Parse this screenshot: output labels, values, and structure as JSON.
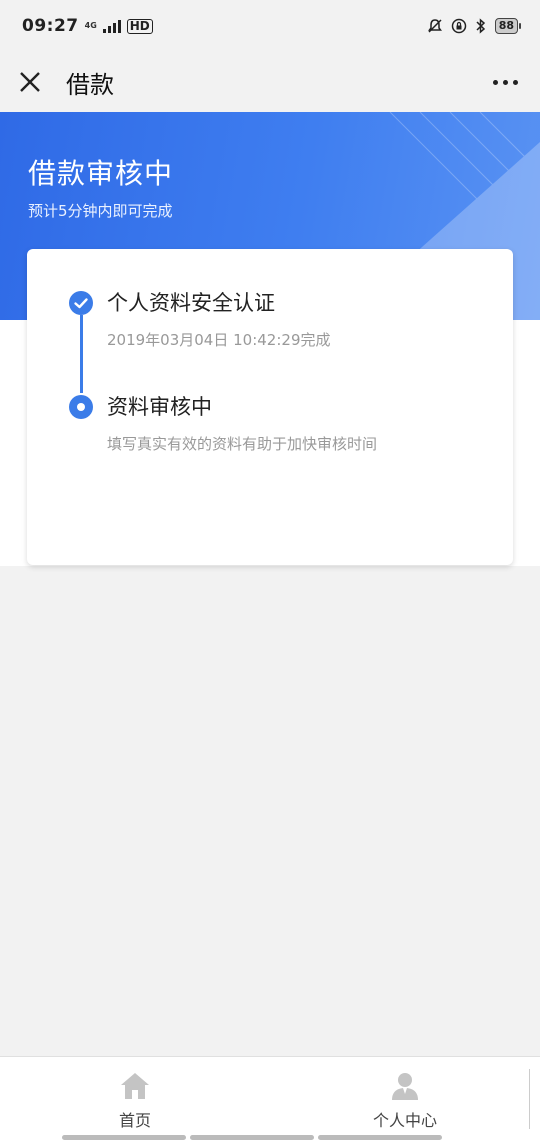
{
  "status_bar": {
    "time": "09:27",
    "network": "4G",
    "hd": "HD",
    "battery": "88"
  },
  "title_bar": {
    "title": "借款"
  },
  "banner": {
    "title": "借款审核中",
    "subtitle": "预计5分钟内即可完成"
  },
  "steps": [
    {
      "title": "个人资料安全认证",
      "subtitle": "2019年03月04日 10:42:29完成",
      "state": "done"
    },
    {
      "title": "资料审核中",
      "subtitle": "填写真实有效的资料有助于加快审核时间",
      "state": "current"
    }
  ],
  "bottom_nav": {
    "items": [
      {
        "label": "首页",
        "icon": "home-icon"
      },
      {
        "label": "个人中心",
        "icon": "user-icon"
      }
    ]
  },
  "colors": {
    "accent": "#3b7ce8",
    "banner": "#3f7ef0",
    "background": "#f2f2f2"
  }
}
